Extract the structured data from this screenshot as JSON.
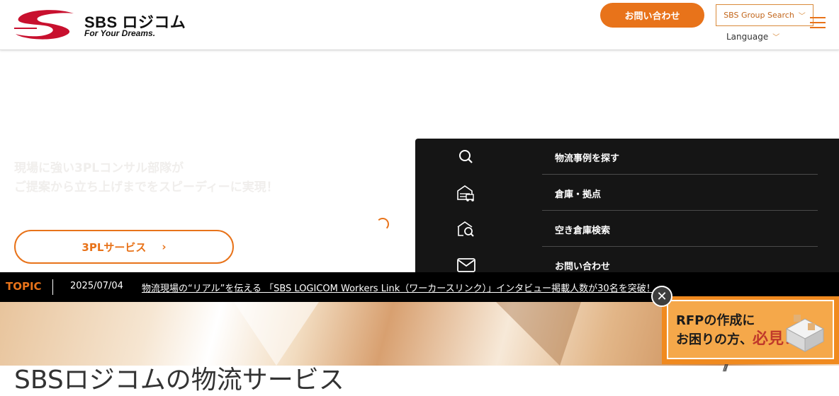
{
  "header": {
    "logo_name": "SBS ロジコム",
    "logo_tagline": "For Your Dreams.",
    "contact_button": "お問い合わせ",
    "group_search": "SBS Group Search",
    "language": "Language"
  },
  "hero": {
    "line1": "現場に強い3PLコンサル部隊が",
    "line2": "ご提案から立ち上げまでをスピーディーに実現！",
    "cta_label": "3PLサービス"
  },
  "menu": {
    "items": [
      {
        "label": "物流事例を探す",
        "icon": "search-icon"
      },
      {
        "label": "倉庫・拠点",
        "icon": "warehouse-truck-icon"
      },
      {
        "label": "空き倉庫検索",
        "icon": "warehouse-search-icon"
      },
      {
        "label": "お問い合わせ",
        "icon": "mail-icon"
      }
    ]
  },
  "topic": {
    "label": "TOPIC",
    "date": "2025/07/04",
    "text": "物流現場の“リアル”を伝える 「SBS LOGICOM Workers Link（ワーカースリンク）」インタビュー掲載人数が30名を突破！"
  },
  "section": {
    "title": "SBSロジコムの物流サービス"
  },
  "rfp_banner": {
    "line1": "RFPの作成に",
    "line2_a": "お困りの方、",
    "line2_b": "必見！"
  },
  "colors": {
    "accent": "#e8731a",
    "menu_bg": "#151515",
    "topic_bg": "#000000"
  }
}
